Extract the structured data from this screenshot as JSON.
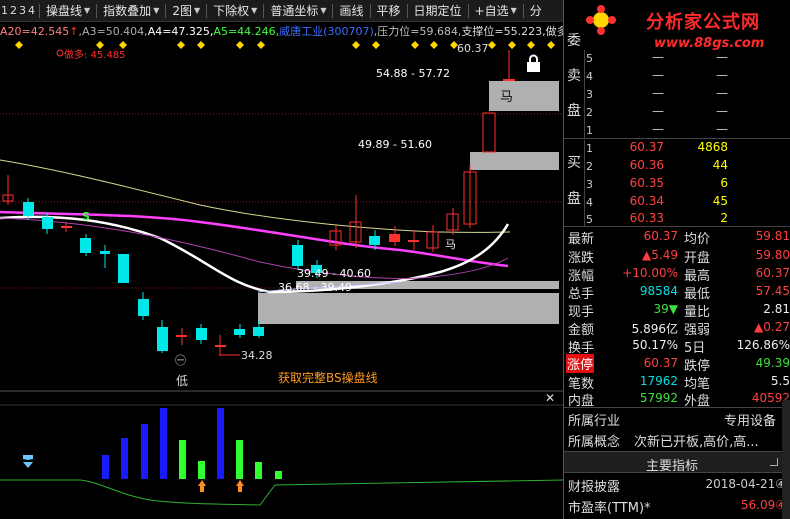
{
  "toolbar": {
    "nums": [
      "1",
      "2",
      "3",
      "4"
    ],
    "items": [
      {
        "label": "操盘线",
        "dropdown": true
      },
      {
        "label": "指数叠加",
        "dropdown": true
      },
      {
        "label": "2图",
        "dropdown": true
      },
      {
        "label": "下除权",
        "dropdown": true
      },
      {
        "label": "普通坐标",
        "dropdown": true
      },
      {
        "label": "画线",
        "dropdown": false
      },
      {
        "label": "平移",
        "dropdown": false
      },
      {
        "label": "日期定位",
        "dropdown": false
      },
      {
        "label": "+自选",
        "dropdown": true
      },
      {
        "label": "分",
        "dropdown": false
      }
    ]
  },
  "indicators": {
    "a20": "A20=42.545",
    "arrow": "↑",
    "a3": ",A3=50.404,",
    "a4": "A4=47.325,",
    "a5": "A5=44.246,",
    "stock": "威唐工业(300707)",
    "pressure": ",压力位=59.684,",
    "support": "支撑位=55.223,",
    "tail": "做多"
  },
  "chart": {
    "zuoduo": "做多: 45.485",
    "top_price": "60.37",
    "box1_range": "54.88 - 57.72",
    "box1_tag": "马",
    "box2_range": "49.89 - 51.60",
    "box3_range": "39.49 - 40.60",
    "box4_range": "36.68 - 39.49",
    "low_price": "34.28",
    "buy_tag": "马",
    "s_tag": "S",
    "low_circle": "㊀",
    "low_label": "低",
    "promo": "获取完整BS操盘线",
    "close_x": "✕",
    "colors": {
      "up": "#ff3030",
      "down": "#00e8e8",
      "ma_white": "#ffffff",
      "ma_magenta": "#ff40ff",
      "ma_yellow": "#e0e080"
    }
  },
  "right_panel": {
    "brand": "分析家公式网",
    "site": "www.88gs.com",
    "sell_label": [
      "委",
      "卖",
      "盘"
    ],
    "sell_levels": [
      {
        "n": "5",
        "p": "—",
        "v": "—"
      },
      {
        "n": "4",
        "p": "—",
        "v": "—"
      },
      {
        "n": "3",
        "p": "—",
        "v": "—"
      },
      {
        "n": "2",
        "p": "—",
        "v": "—"
      },
      {
        "n": "1",
        "p": "—",
        "v": "—"
      }
    ],
    "buy_label": [
      "买",
      "盘"
    ],
    "buy_levels": [
      {
        "n": "1",
        "p": "60.37",
        "v": "4868"
      },
      {
        "n": "2",
        "p": "60.36",
        "v": "44"
      },
      {
        "n": "3",
        "p": "60.35",
        "v": "6"
      },
      {
        "n": "4",
        "p": "60.34",
        "v": "45"
      },
      {
        "n": "5",
        "p": "60.33",
        "v": "2"
      }
    ],
    "quotes": [
      {
        "l1": "最新",
        "v1": "60.37",
        "c1": "red",
        "l2": "均价",
        "v2": "59.81",
        "c2": "red"
      },
      {
        "l1": "涨跌",
        "v1": "▲5.49",
        "c1": "red",
        "l2": "开盘",
        "v2": "59.80",
        "c2": "red"
      },
      {
        "l1": "涨幅",
        "v1": "+10.00%",
        "c1": "red",
        "l2": "最高",
        "v2": "60.37",
        "c2": "red"
      },
      {
        "l1": "总手",
        "v1": "98584",
        "c1": "cyan",
        "l2": "最低",
        "v2": "57.45",
        "c2": "red"
      },
      {
        "l1": "现手",
        "v1": "39▼",
        "c1": "green",
        "l2": "量比",
        "v2": "2.81",
        "c2": "white"
      },
      {
        "l1": "金额",
        "v1": "5.896亿",
        "c1": "white",
        "l2": "强弱",
        "v2": "▲0.27",
        "c2": "red"
      },
      {
        "l1": "换手",
        "v1": "50.17%",
        "c1": "white",
        "l2": "5日",
        "v2": "126.86%",
        "c2": "white"
      },
      {
        "l1": "涨停",
        "v1": "60.37",
        "c1": "red",
        "l2": "跌停",
        "v2": "49.39",
        "c2": "green"
      },
      {
        "l1": "笔数",
        "v1": "17962",
        "c1": "cyan",
        "l2": "均笔",
        "v2": "5.5",
        "c2": "white"
      },
      {
        "l1": "内盘",
        "v1": "57992",
        "c1": "green",
        "l2": "外盘",
        "v2": "40592",
        "c2": "red"
      }
    ],
    "industry_label": "所属行业",
    "industry_value": "专用设备",
    "concept_label": "所属概念",
    "concept_value": "次新已开板,高价,高...",
    "main_metrics": "主要指标",
    "disclosure_label": "财报披露",
    "disclosure_value": "2018-04-21④",
    "pe_label": "市盈率(TTM)*",
    "pe_value": "56.09④"
  }
}
